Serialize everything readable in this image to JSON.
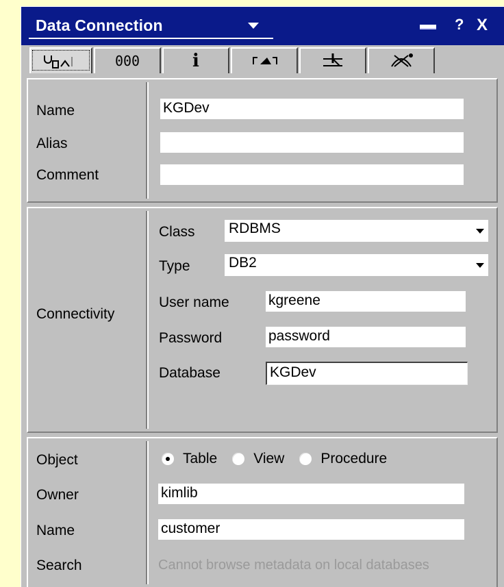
{
  "window": {
    "title": "Data Connection",
    "help_label": "?",
    "close_label": "X"
  },
  "tabs": [
    {
      "icon": "connection-plug-icon",
      "label": ""
    },
    {
      "icon": "columns-icon",
      "label": "000"
    },
    {
      "icon": "info-icon",
      "label": "i"
    },
    {
      "icon": "flag-icon",
      "label": ""
    },
    {
      "icon": "pencil-icon",
      "label": ""
    },
    {
      "icon": "chart-icon",
      "label": ""
    }
  ],
  "general": {
    "name_label": "Name",
    "name_value": "KGDev",
    "alias_label": "Alias",
    "alias_value": "",
    "comment_label": "Comment",
    "comment_value": ""
  },
  "connectivity": {
    "section_label": "Connectivity",
    "class_label": "Class",
    "class_value": "RDBMS",
    "type_label": "Type",
    "type_value": "DB2",
    "username_label": "User name",
    "username_value": "kgreene",
    "password_label": "Password",
    "password_value": "password",
    "database_label": "Database",
    "database_value": "KGDev"
  },
  "object": {
    "object_label": "Object",
    "options": [
      "Table",
      "View",
      "Procedure"
    ],
    "selected": "Table",
    "owner_label": "Owner",
    "owner_value": "kimlib",
    "name_label": "Name",
    "name_value": "customer",
    "search_label": "Search",
    "search_message": "Cannot browse metadata on local databases"
  }
}
